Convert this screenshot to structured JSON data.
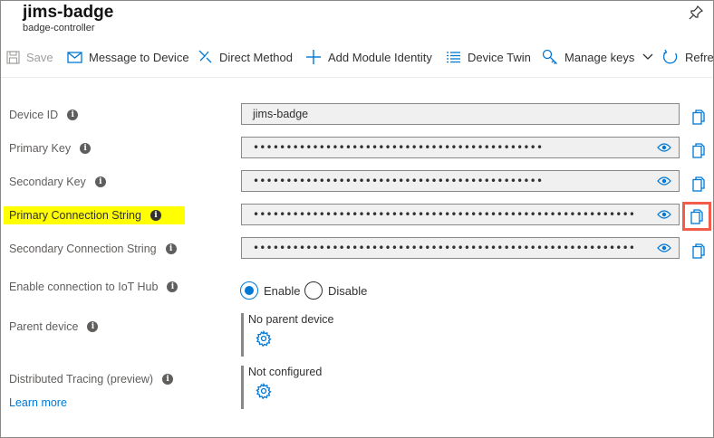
{
  "header": {
    "title": "jims-badge",
    "subtitle": "badge-controller"
  },
  "toolbar": {
    "save": "Save",
    "message": "Message to Device",
    "direct_method": "Direct Method",
    "add_module": "Add Module Identity",
    "device_twin": "Device Twin",
    "manage_keys": "Manage keys",
    "refresh": "Refresh"
  },
  "fields": {
    "device_id": {
      "label": "Device ID",
      "value": "jims-badge"
    },
    "primary_key": {
      "label": "Primary Key",
      "value": "••••••••••••••••••••••••••••••••••••••••••••"
    },
    "secondary_key": {
      "label": "Secondary Key",
      "value": "••••••••••••••••••••••••••••••••••••••••••••"
    },
    "primary_conn": {
      "label": "Primary Connection String",
      "value": "•••••••••••••••••••••••••••••••••••••••••••••••••••••••••••••••••••••••••••••••••••••••••••••••••..."
    },
    "secondary_conn": {
      "label": "Secondary Connection String",
      "value": "•••••••••••••••••••••••••••••••••••••••••••••••••••••••••••••••••••••••••••••••••••••••••••••••••..."
    }
  },
  "connection": {
    "label": "Enable connection to IoT Hub",
    "enable": "Enable",
    "disable": "Disable",
    "selected": "Enable"
  },
  "parent": {
    "label": "Parent device",
    "value": "No parent device"
  },
  "tracing": {
    "label": "Distributed Tracing (preview)",
    "value": "Not configured",
    "learn_more": "Learn more"
  },
  "colors": {
    "accent": "#0078d4",
    "highlight": "#ffff00",
    "callout": "#f25c4a"
  }
}
